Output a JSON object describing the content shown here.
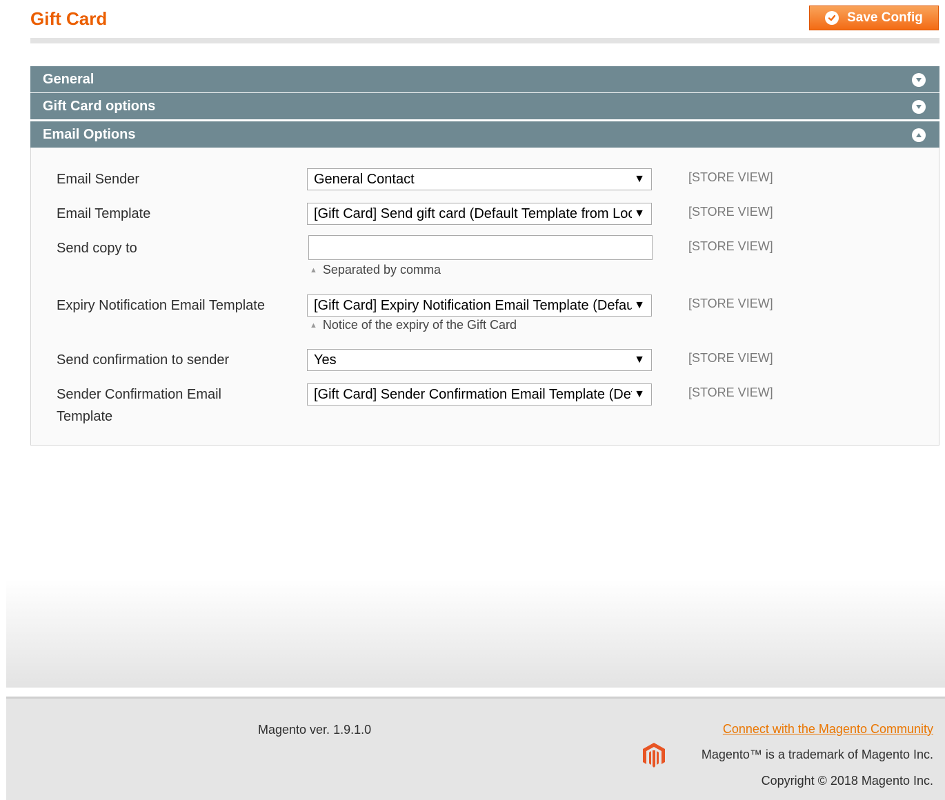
{
  "page": {
    "title": "Gift Card",
    "save_label": "Save Config"
  },
  "sections": [
    {
      "label": "General",
      "state": "collapsed",
      "icon": "chevron-down-icon"
    },
    {
      "label": "Gift Card options",
      "state": "collapsed",
      "icon": "chevron-down-icon"
    },
    {
      "label": "Email Options",
      "state": "expanded",
      "icon": "chevron-up-icon"
    }
  ],
  "fields": {
    "email_sender": {
      "label": "Email Sender",
      "value": "General Contact",
      "scope": "[STORE VIEW]"
    },
    "email_template": {
      "label": "Email Template",
      "value": "[Gift Card] Send gift card (Default Template from Locale)",
      "scope": "[STORE VIEW]"
    },
    "send_copy_to": {
      "label": "Send copy to",
      "value": "",
      "note": "Separated by comma",
      "scope": "[STORE VIEW]"
    },
    "expiry_template": {
      "label": "Expiry Notification Email Template",
      "value": "[Gift Card] Expiry Notification Email Template (Default Template from Locale)",
      "note": "Notice of the expiry of the Gift Card",
      "scope": "[STORE VIEW]"
    },
    "send_confirmation": {
      "label": "Send confirmation to sender",
      "value": "Yes",
      "scope": "[STORE VIEW]"
    },
    "sender_confirmation_template": {
      "label_line1": "Sender Confirmation Email",
      "label_line2": "Template",
      "value": "[Gift Card] Sender Confirmation Email Template (Default Template from Locale)",
      "scope": "[STORE VIEW]"
    }
  },
  "footer": {
    "version": "Magento ver. 1.9.1.0",
    "community_link": "Connect with the Magento Community",
    "trademark": "Magento™ is a trademark of Magento Inc.",
    "copyright": "Copyright © 2018 Magento Inc."
  },
  "colors": {
    "accent": "#eb5e00",
    "section_header": "#6f8992",
    "link": "#ea7601"
  }
}
